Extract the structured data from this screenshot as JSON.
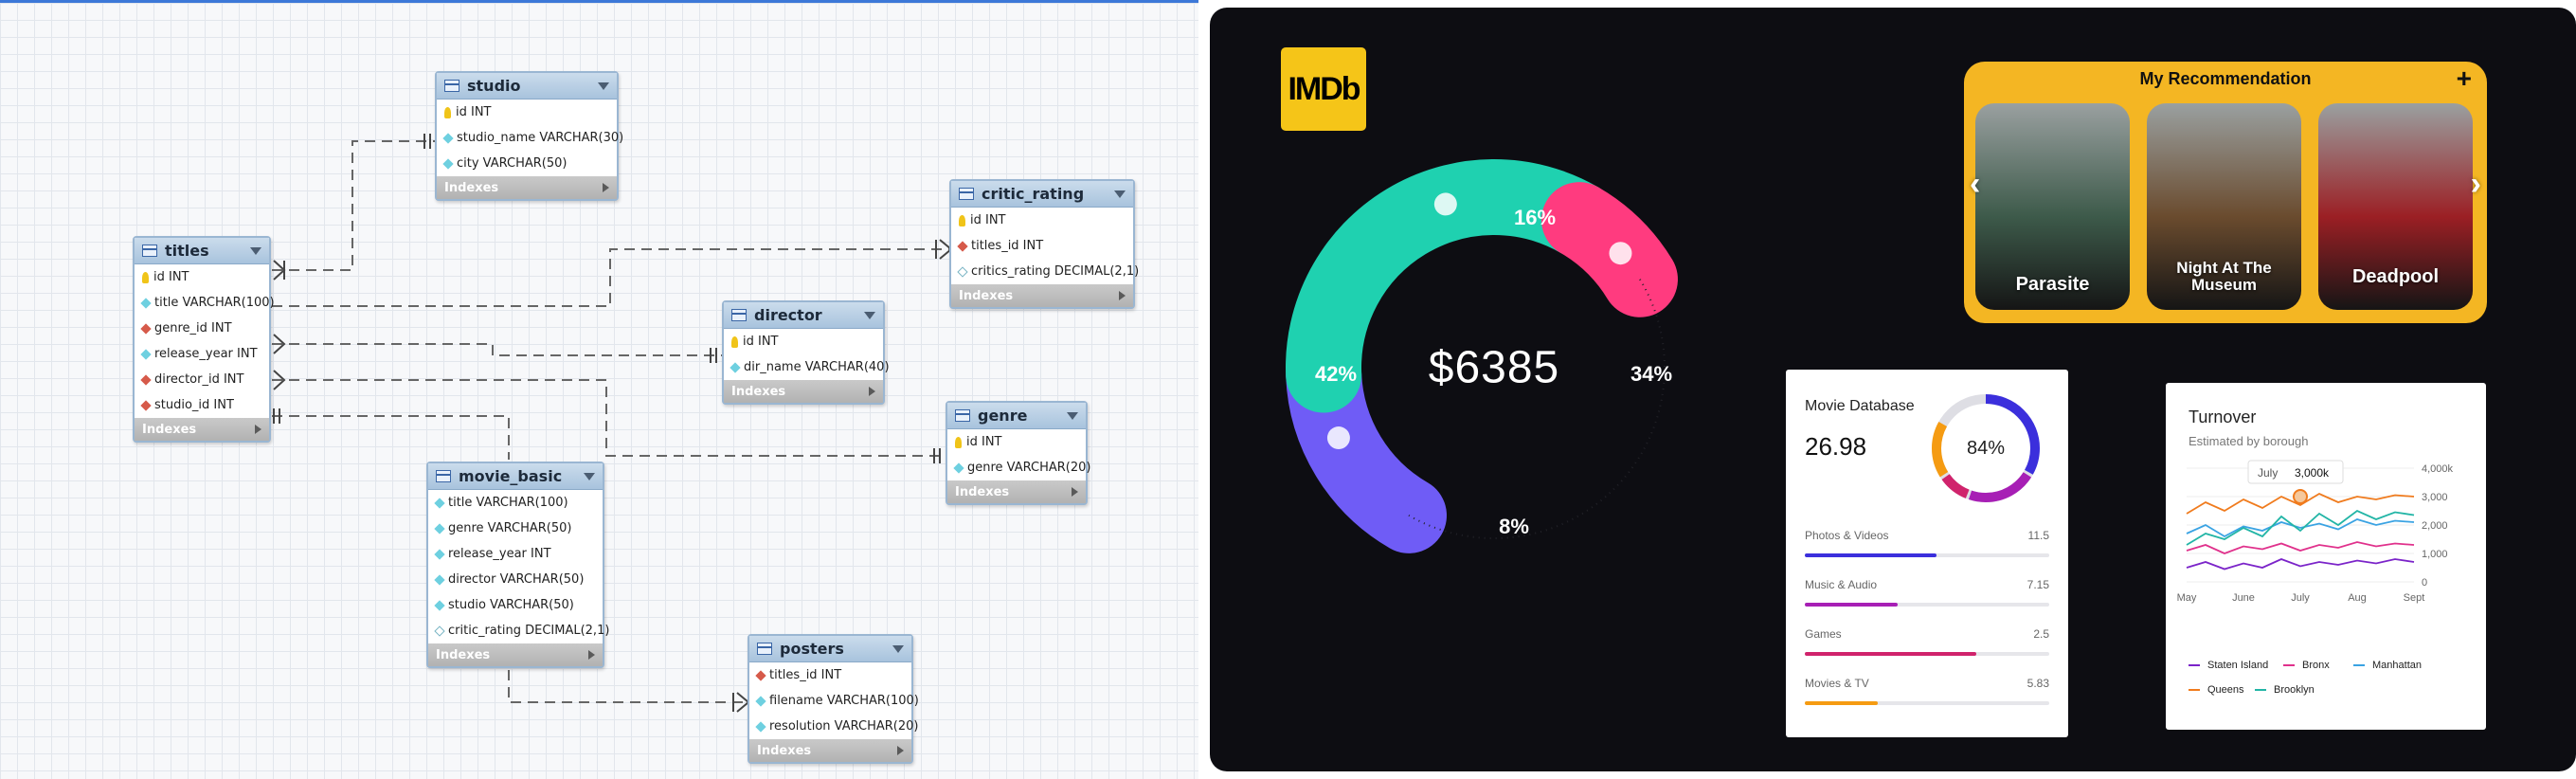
{
  "erd": {
    "footer_label": "Indexes",
    "tables": [
      {
        "name": "titles",
        "columns": [
          {
            "key": "pk",
            "text": "id INT"
          },
          {
            "key": "col",
            "text": "title VARCHAR(100)"
          },
          {
            "key": "fk",
            "text": "genre_id INT"
          },
          {
            "key": "col",
            "text": "release_year INT"
          },
          {
            "key": "fk",
            "text": "director_id INT"
          },
          {
            "key": "fk",
            "text": "studio_id INT"
          }
        ]
      },
      {
        "name": "studio",
        "columns": [
          {
            "key": "pk",
            "text": "id INT"
          },
          {
            "key": "col",
            "text": "studio_name VARCHAR(30)"
          },
          {
            "key": "col",
            "text": "city VARCHAR(50)"
          }
        ]
      },
      {
        "name": "critic_rating",
        "columns": [
          {
            "key": "pk",
            "text": "id INT"
          },
          {
            "key": "fk",
            "text": "titles_id INT"
          },
          {
            "key": "null",
            "text": "critics_rating DECIMAL(2,1)"
          }
        ]
      },
      {
        "name": "director",
        "columns": [
          {
            "key": "pk",
            "text": "id INT"
          },
          {
            "key": "col",
            "text": "dir_name VARCHAR(40)"
          }
        ]
      },
      {
        "name": "genre",
        "columns": [
          {
            "key": "pk",
            "text": "id INT"
          },
          {
            "key": "col",
            "text": "genre VARCHAR(20)"
          }
        ]
      },
      {
        "name": "movie_basic",
        "columns": [
          {
            "key": "col",
            "text": "title VARCHAR(100)"
          },
          {
            "key": "col",
            "text": "genre VARCHAR(50)"
          },
          {
            "key": "col",
            "text": "release_year INT"
          },
          {
            "key": "col",
            "text": "director VARCHAR(50)"
          },
          {
            "key": "col",
            "text": "studio VARCHAR(50)"
          },
          {
            "key": "null",
            "text": "critic_rating DECIMAL(2,1)"
          }
        ]
      },
      {
        "name": "posters",
        "columns": [
          {
            "key": "fk",
            "text": "titles_id INT"
          },
          {
            "key": "col",
            "text": "filename VARCHAR(100)"
          },
          {
            "key": "col",
            "text": "resolution VARCHAR(20)"
          }
        ]
      }
    ]
  },
  "dashboard": {
    "logo": "IMDb",
    "donut": {
      "total": "$6385",
      "segments": [
        {
          "label": "16%",
          "value": 16,
          "color": "#6f5cf6"
        },
        {
          "label": "34%",
          "value": 34,
          "color": "#1fd1b0"
        },
        {
          "label": "8%",
          "value": 8,
          "color": "#ff3b7f"
        },
        {
          "label": "42%",
          "value": 42,
          "color": "#222228"
        }
      ]
    },
    "recommendation": {
      "title": "My Recommendation",
      "add_icon": "+",
      "prev_icon": "‹",
      "next_icon": "›",
      "movies": [
        {
          "title": "Parasite",
          "color": "#3d5a4a"
        },
        {
          "title": "Night At The Museum",
          "color": "#6a4b2e"
        },
        {
          "title": "Deadpool",
          "color": "#9b1f24"
        }
      ]
    },
    "movie_database": {
      "title": "Movie Database",
      "value": "26.98",
      "ring_percent": "84%",
      "ring_value": 0.84,
      "categories": [
        {
          "label": "Photos & Videos",
          "value": "11.5",
          "fill": 0.54,
          "color": "#3b2fdc"
        },
        {
          "label": "Music & Audio",
          "value": "7.15",
          "fill": 0.38,
          "color": "#a71fb5"
        },
        {
          "label": "Games",
          "value": "2.5",
          "fill": 0.7,
          "color": "#d0236c"
        },
        {
          "label": "Movies & TV",
          "value": "5.83",
          "fill": 0.3,
          "color": "#f59b12"
        }
      ]
    },
    "turnover": {
      "title": "Turnover",
      "subtitle": "Estimated by borough",
      "tooltip_month": "July",
      "tooltip_value": "3,000k"
    }
  },
  "chart_data": {
    "type": "line",
    "title": "Turnover",
    "subtitle": "Estimated by borough",
    "x": [
      "May",
      "June",
      "July",
      "Aug",
      "Sept"
    ],
    "y_ticks": [
      "0",
      "1,000",
      "2,000",
      "3,000",
      "4,000k"
    ],
    "ylim": [
      0,
      4000
    ],
    "legend_position": "bottom",
    "series": [
      {
        "name": "Staten Island",
        "color": "#7b24c9",
        "values": [
          500,
          700,
          450,
          650,
          500,
          800,
          550,
          700,
          600,
          750,
          650,
          800,
          700
        ]
      },
      {
        "name": "Bronx",
        "color": "#e0318c",
        "values": [
          1100,
          1300,
          1000,
          1250,
          1150,
          1350,
          1100,
          1300,
          1200,
          1400,
          1250,
          1350,
          1300
        ]
      },
      {
        "name": "Manhattan",
        "color": "#3aa3e3",
        "values": [
          1700,
          2000,
          1600,
          1950,
          1800,
          2100,
          1900,
          2050,
          1850,
          2200,
          2000,
          2150,
          2100
        ]
      },
      {
        "name": "Queens",
        "color": "#f07b1d",
        "values": [
          2400,
          2800,
          2500,
          2900,
          2600,
          3000,
          2700,
          3100,
          2800,
          3000,
          2900,
          3050,
          3000
        ]
      },
      {
        "name": "Brooklyn",
        "color": "#22b5a6",
        "values": [
          1300,
          1700,
          1500,
          1900,
          1600,
          2300,
          1800,
          2400,
          2000,
          2500,
          2200,
          2450,
          2350
        ]
      }
    ]
  }
}
